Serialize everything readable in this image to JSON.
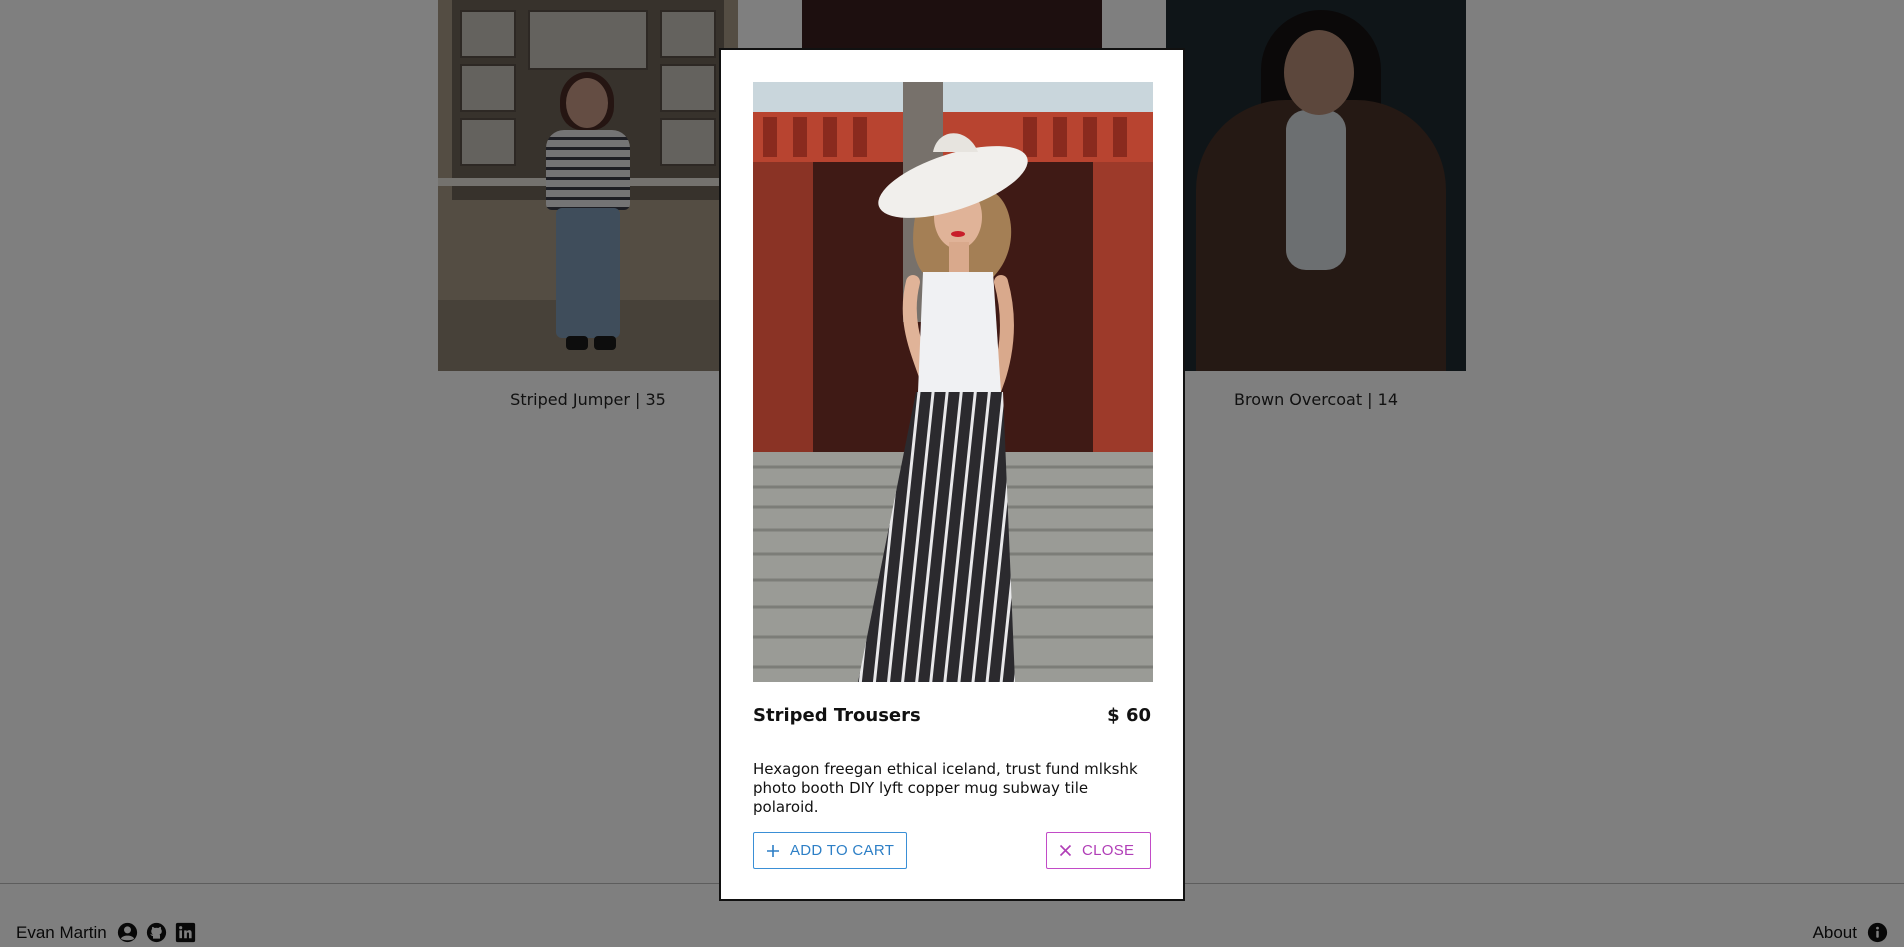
{
  "products": [
    {
      "label": "Striped Jumper | 35"
    },
    {
      "label": "Brown Overcoat | 14"
    }
  ],
  "modal": {
    "title": "Striped Trousers",
    "price": "$ 60",
    "description": "Hexagon freegan ethical iceland, trust fund mlkshk photo booth DIY lyft copper mug subway tile polaroid.",
    "add_to_cart_label": "ADD TO CART",
    "close_label": "CLOSE"
  },
  "footer": {
    "name": "Evan Martin",
    "about_label": "About",
    "icons": [
      "user-circle-icon",
      "github-icon",
      "linkedin-icon",
      "info-icon"
    ]
  },
  "colors": {
    "add_button": "#2d7fc6",
    "close_button": "#b13eb7",
    "overlay": "rgba(0,0,0,0.5)"
  }
}
